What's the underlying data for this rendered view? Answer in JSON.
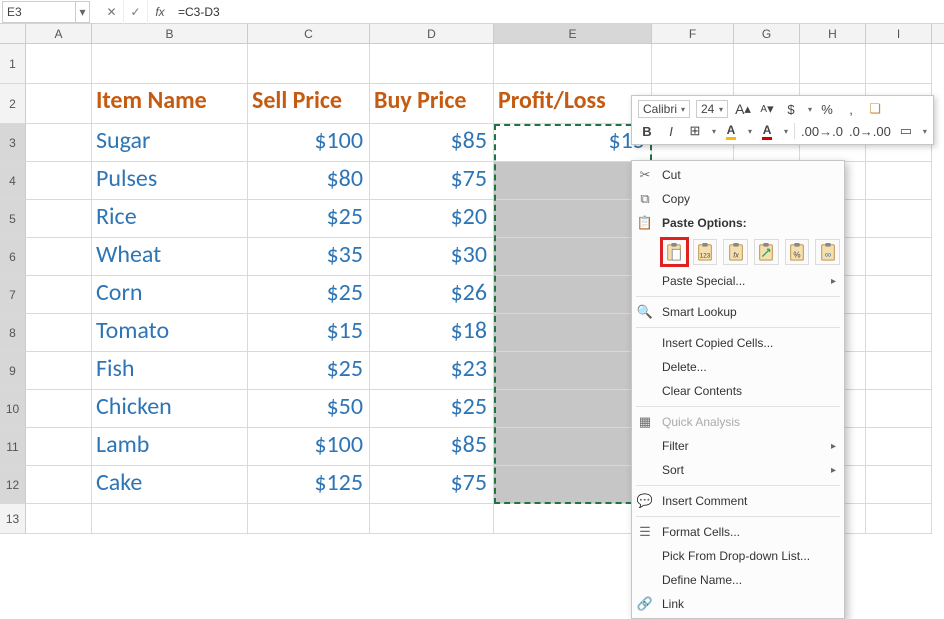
{
  "formula_bar": {
    "name_box": "E3",
    "formula": "=C3-D3"
  },
  "columns": [
    "A",
    "B",
    "C",
    "D",
    "E",
    "F",
    "G",
    "H",
    "I"
  ],
  "row_numbers": [
    "1",
    "2",
    "3",
    "4",
    "5",
    "6",
    "7",
    "8",
    "9",
    "10",
    "11",
    "12",
    "13"
  ],
  "headers": {
    "B": "Item Name",
    "C": "Sell Price",
    "D": "Buy Price",
    "E": "Profit/Loss"
  },
  "table_rows": [
    {
      "item": "Sugar",
      "sell": "$100",
      "buy": "$85",
      "pl": "$15"
    },
    {
      "item": "Pulses",
      "sell": "$80",
      "buy": "$75",
      "pl": ""
    },
    {
      "item": "Rice",
      "sell": "$25",
      "buy": "$20",
      "pl": ""
    },
    {
      "item": "Wheat",
      "sell": "$35",
      "buy": "$30",
      "pl": ""
    },
    {
      "item": "Corn",
      "sell": "$25",
      "buy": "$26",
      "pl": ""
    },
    {
      "item": "Tomato",
      "sell": "$15",
      "buy": "$18",
      "pl": ""
    },
    {
      "item": "Fish",
      "sell": "$25",
      "buy": "$23",
      "pl": ""
    },
    {
      "item": "Chicken",
      "sell": "$50",
      "buy": "$25",
      "pl": ""
    },
    {
      "item": "Lamb",
      "sell": "$100",
      "buy": "$85",
      "pl": ""
    },
    {
      "item": "Cake",
      "sell": "$125",
      "buy": "$75",
      "pl": ""
    }
  ],
  "mini_toolbar": {
    "font_name": "Calibri",
    "font_size": "24",
    "increase_font": "A",
    "decrease_font": "A",
    "currency": "$",
    "percent": "%",
    "comma": ",",
    "bold": "B",
    "italic": "I",
    "fill_letter": "A",
    "font_letter": "A"
  },
  "context_menu": {
    "cut": "Cut",
    "copy": "Copy",
    "paste_options": "Paste Options:",
    "paste_btns": {
      "paste": "Paste",
      "values": "123",
      "formulas": "fx",
      "transpose": "Transpose",
      "formatting": "%",
      "link": "Link"
    },
    "paste_special": "Paste Special...",
    "smart_lookup": "Smart Lookup",
    "insert_copied": "Insert Copied Cells...",
    "delete": "Delete...",
    "clear_contents": "Clear Contents",
    "quick_analysis": "Quick Analysis",
    "filter": "Filter",
    "sort": "Sort",
    "insert_comment": "Insert Comment",
    "format_cells": "Format Cells...",
    "pick_dropdown": "Pick From Drop-down List...",
    "define_name": "Define Name...",
    "link": "Link"
  }
}
